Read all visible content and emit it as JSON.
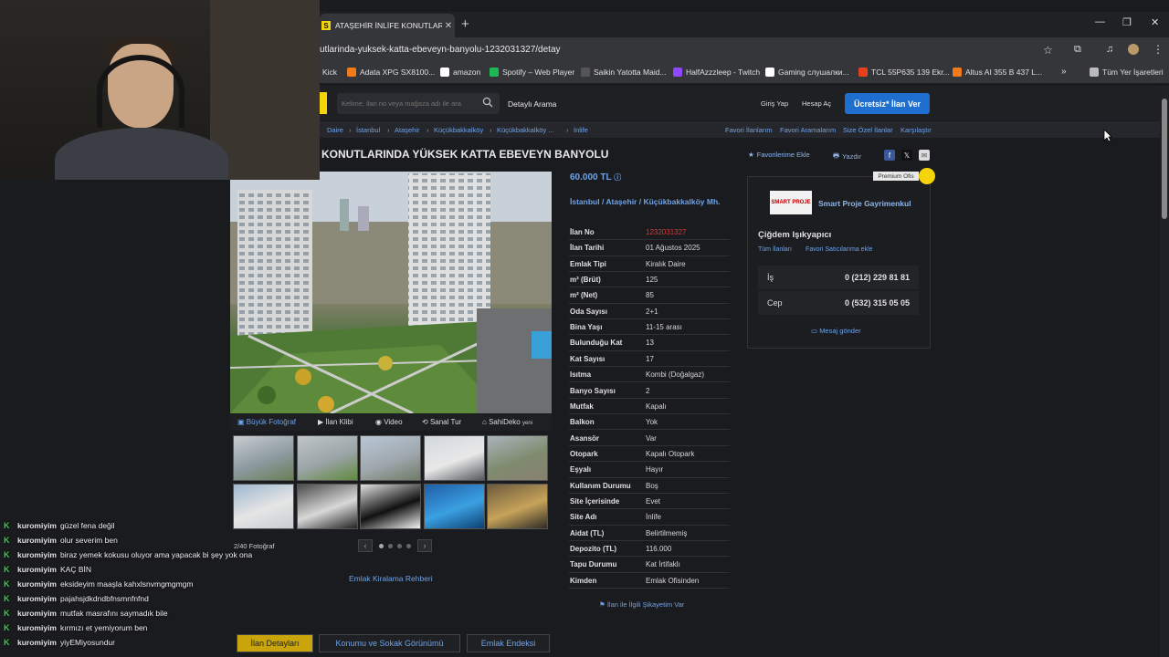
{
  "browser": {
    "tab_title": "ATAŞEHİR İNLİFE KONUTLARINDA",
    "tab_favicon": "S",
    "new_tab": "+",
    "url": "utlarinda-yuksek-katta-ebeveyn-banyolu-1232031327/detay",
    "bookmarks": [
      {
        "label": "Kick",
        "color": "#53fc18"
      },
      {
        "label": "Adata XPG SX8100...",
        "color": "#f27a1a"
      },
      {
        "label": "amazon",
        "color": "#ffffff"
      },
      {
        "label": "Spotify – Web Player",
        "color": "#1db954"
      },
      {
        "label": "Saikin Yatotta Maid...",
        "color": "#555555"
      },
      {
        "label": "HalfAzzzleep - Twitch",
        "color": "#9146ff"
      },
      {
        "label": "Gaming слушалки...",
        "color": "#ffffff"
      },
      {
        "label": "TCL 55P635 139 Ekr...",
        "color": "#e8401c"
      },
      {
        "label": "Altus AI 355 B 437 L...",
        "color": "#f27a1a"
      },
      {
        "label": "Tüm Yer İşaretleri",
        "color": "#bbbbbb"
      }
    ],
    "more_bookmarks": "»"
  },
  "site": {
    "search_placeholder": "Kelime, ilan no veya mağaza adı ile ara",
    "detailed_search": "Detaylı Arama",
    "login": "Giriş Yap",
    "signup": "Hesap Aç",
    "post_ad": "Ücretsiz* İlan Ver"
  },
  "breadcrumb": [
    "Daire",
    "İstanbul",
    "Ataşehir",
    "Küçükbakkalköy",
    "Küçükbakkalköy ...",
    "İnlife"
  ],
  "top_links": [
    "Favori İlanlarım",
    "Favori Aramalarım",
    "Size Özel İlanlar",
    "Karşılaştır"
  ],
  "listing": {
    "title": "KONUTLARINDA YÜKSEK KATTA EBEVEYN BANYOLU",
    "add_favorite": "Favorilerime Ekle",
    "print": "Yazdır",
    "price": "60.000 TL",
    "location": "İstanbul / Ataşehir / Küçükbakkalköy Mh.",
    "details": [
      {
        "k": "İlan No",
        "v": "1232031327",
        "highlight": true
      },
      {
        "k": "İlan Tarihi",
        "v": "01 Ağustos 2025"
      },
      {
        "k": "Emlak Tipi",
        "v": "Kiralık Daire"
      },
      {
        "k": "m² (Brüt)",
        "v": "125"
      },
      {
        "k": "m² (Net)",
        "v": "85"
      },
      {
        "k": "Oda Sayısı",
        "v": "2+1"
      },
      {
        "k": "Bina Yaşı",
        "v": "11-15 arası"
      },
      {
        "k": "Bulunduğu Kat",
        "v": "13"
      },
      {
        "k": "Kat Sayısı",
        "v": "17"
      },
      {
        "k": "Isıtma",
        "v": "Kombi (Doğalgaz)"
      },
      {
        "k": "Banyo Sayısı",
        "v": "2"
      },
      {
        "k": "Mutfak",
        "v": "Kapalı"
      },
      {
        "k": "Balkon",
        "v": "Yok"
      },
      {
        "k": "Asansör",
        "v": "Var"
      },
      {
        "k": "Otopark",
        "v": "Kapalı Otopark"
      },
      {
        "k": "Eşyalı",
        "v": "Hayır"
      },
      {
        "k": "Kullanım Durumu",
        "v": "Boş"
      },
      {
        "k": "Site İçerisinde",
        "v": "Evet"
      },
      {
        "k": "Site Adı",
        "v": "İnlife"
      },
      {
        "k": "Aidat (TL)",
        "v": "Belirtilmemiş"
      },
      {
        "k": "Depozito (TL)",
        "v": "116.000"
      },
      {
        "k": "Tapu Durumu",
        "v": "Kat İrtifaklı"
      },
      {
        "k": "Kimden",
        "v": "Emlak Ofisinden"
      }
    ],
    "complaint": "İlan ile İlgili Şikayetim Var"
  },
  "photos": {
    "tabs": [
      "Büyük Fotoğraf",
      "İlan Klibi",
      "Video",
      "Sanal Tur",
      "SahiDeko"
    ],
    "new_badge": "yeni",
    "count": "2/40 Fotoğraf",
    "guide": "Emlak Kiralama Rehberi"
  },
  "agent": {
    "premium": "Premium Ofis",
    "name": "Smart Proje Gayrimenkul",
    "logo_text": "SMART PROJE",
    "rep": "Çiğdem Işıkyapıcı",
    "all_listings": "Tüm İlanları",
    "add_fav_seller": "Favori Satıcılarıma ekle",
    "phones": [
      {
        "k": "İş",
        "v": "0 (212) 229 81 81"
      },
      {
        "k": "Cep",
        "v": "0 (532) 315 05 05"
      }
    ],
    "send_message": "Mesaj gönder"
  },
  "bottom_tabs": [
    "İlan Detayları",
    "Konumu ve Sokak Görünümü",
    "Emlak Endeksi"
  ],
  "chat": [
    {
      "user": "kuromiyim",
      "text": "güzel fena değil"
    },
    {
      "user": "kuromiyim",
      "text": "olur severim ben"
    },
    {
      "user": "kuromiyim",
      "text": "biraz yemek kokusu oluyor ama yapacak bi şey yok ona"
    },
    {
      "user": "kuromiyim",
      "text": "KAÇ BİN"
    },
    {
      "user": "kuromiyim",
      "text": "eksideyim maaşla kahxlsnvmgmgmgm"
    },
    {
      "user": "kuromiyim",
      "text": "pajahsjdkdndbfnsmnfnfnd"
    },
    {
      "user": "kuromiyim",
      "text": "mutfak masrafını saymadık bile"
    },
    {
      "user": "kuromiyim",
      "text": "kırmızı et yemiyorum ben"
    },
    {
      "user": "kuromiyim",
      "text": "yiyEMiyosundur"
    }
  ]
}
